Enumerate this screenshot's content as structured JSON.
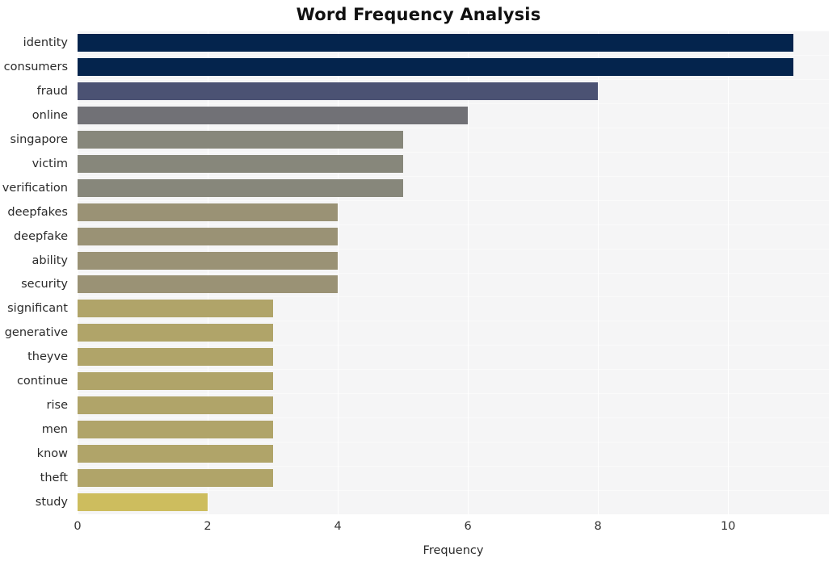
{
  "chart_data": {
    "type": "bar",
    "orientation": "horizontal",
    "title": "Word Frequency Analysis",
    "xlabel": "Frequency",
    "ylabel": "",
    "categories": [
      "identity",
      "consumers",
      "fraud",
      "online",
      "singapore",
      "victim",
      "verification",
      "deepfakes",
      "deepfake",
      "ability",
      "security",
      "significant",
      "generative",
      "theyve",
      "continue",
      "rise",
      "men",
      "know",
      "theft",
      "study"
    ],
    "values": [
      11,
      11,
      8,
      6,
      5,
      5,
      5,
      4,
      4,
      4,
      4,
      3,
      3,
      3,
      3,
      3,
      3,
      3,
      3,
      2
    ],
    "bar_colors": [
      "#04244d",
      "#04244d",
      "#4b5273",
      "#717176",
      "#87877b",
      "#87877b",
      "#87877b",
      "#9a9275",
      "#9a9275",
      "#9a9275",
      "#9a9275",
      "#b0a469",
      "#b0a469",
      "#b0a469",
      "#b0a469",
      "#b0a469",
      "#b0a469",
      "#b0a469",
      "#b0a469",
      "#cdbd5e"
    ],
    "xticks": [
      0,
      2,
      4,
      6,
      8,
      10
    ],
    "xtick_labels": [
      "0",
      "2",
      "4",
      "6",
      "8",
      "10"
    ],
    "xlim": [
      0,
      11.55
    ],
    "grid": true,
    "grid_axis": "both",
    "plot_background": "#f5f5f6",
    "figure_background": "#ffffff",
    "legend": null
  }
}
